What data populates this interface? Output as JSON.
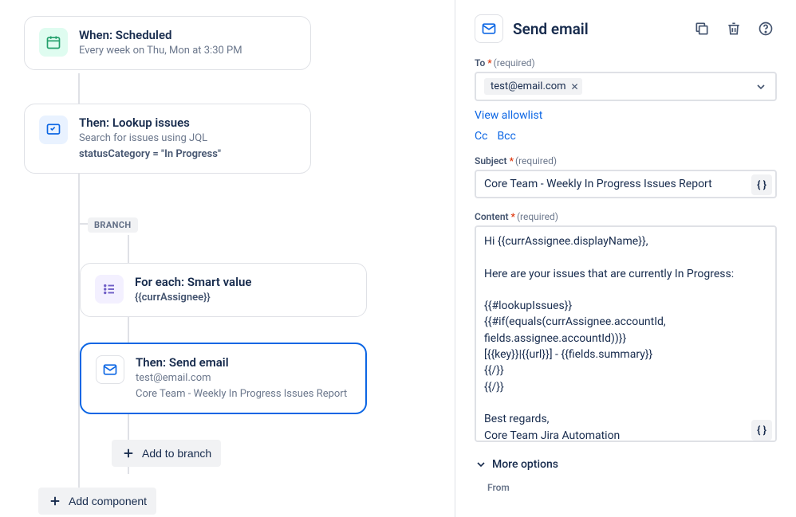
{
  "flow": {
    "trigger": {
      "title": "When: Scheduled",
      "desc": "Every week on Thu, Mon at 3:30 PM"
    },
    "lookup": {
      "title": "Then: Lookup issues",
      "desc1": "Search for issues using JQL",
      "desc2": "statusCategory = \"In Progress\""
    },
    "branch_label": "BRANCH",
    "foreach": {
      "title": "For each: Smart value",
      "desc": "{{currAssignee}}"
    },
    "sendemail": {
      "title": "Then: Send email",
      "desc1": "test@email.com",
      "desc2": "Core Team - Weekly In Progress Issues Report"
    },
    "add_branch": "Add to branch",
    "add_component": "Add component"
  },
  "panel": {
    "title": "Send email",
    "to": {
      "label": "To",
      "hint": "(required)",
      "chip": "test@email.com"
    },
    "view_allowlist": "View allowlist",
    "cc": "Cc",
    "bcc": "Bcc",
    "subject": {
      "label": "Subject",
      "hint": "(required)",
      "value": "Core Team - Weekly In Progress Issues Report"
    },
    "content": {
      "label": "Content",
      "hint": "(required)",
      "value": "Hi {{currAssignee.displayName}},\n\nHere are your issues that are currently In Progress:\n\n{{#lookupIssues}}\n{{#if(equals(currAssignee.accountId, fields.assignee.accountId))}}\n[{{key}}|{{url}}] - {{fields.summary}}\n{{/}}\n{{/}}\n\nBest regards,\nCore Team Jira Automation"
    },
    "more_options": "More options",
    "from_label": "From"
  }
}
